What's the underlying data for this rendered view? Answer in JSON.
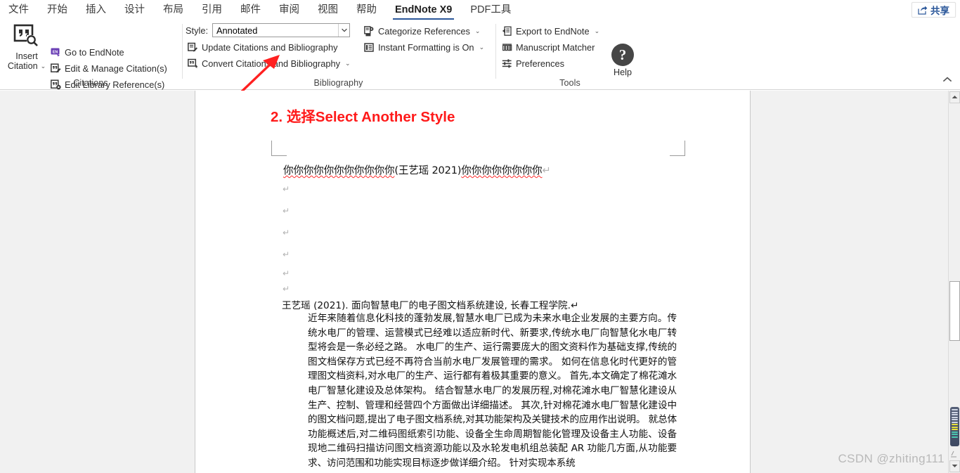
{
  "app": {
    "tabs": [
      {
        "label": "文件",
        "active": false
      },
      {
        "label": "开始",
        "active": false
      },
      {
        "label": "插入",
        "active": false
      },
      {
        "label": "设计",
        "active": false
      },
      {
        "label": "布局",
        "active": false
      },
      {
        "label": "引用",
        "active": false
      },
      {
        "label": "邮件",
        "active": false
      },
      {
        "label": "审阅",
        "active": false
      },
      {
        "label": "视图",
        "active": false
      },
      {
        "label": "帮助",
        "active": false
      },
      {
        "label": "EndNote X9",
        "active": true
      },
      {
        "label": "PDF工具",
        "active": false
      }
    ],
    "share_label": "共享",
    "share_icon": "share-icon",
    "accent_color": "#2b579a"
  },
  "ribbon": {
    "collapse_icon": "chevron-up-icon",
    "groups": [
      {
        "name": "citations",
        "label": "Citations",
        "big_button": {
          "line1": "Insert",
          "line2": "Citation",
          "icon": "insert-citation-icon",
          "caret": "⌄"
        },
        "items": [
          {
            "label": "Go to EndNote",
            "icon": "endnote-icon",
            "caret": ""
          },
          {
            "label": "Edit & Manage Citation(s)",
            "icon": "edit-citation-icon",
            "caret": ""
          },
          {
            "label": "Edit Library Reference(s)",
            "icon": "edit-library-icon",
            "caret": ""
          }
        ]
      },
      {
        "name": "bibliography",
        "label": "Bibliography",
        "style": {
          "label": "Style:",
          "value": "Annotated",
          "placeholder": "Annotated",
          "dropdown_icon": "chevron-down-icon"
        },
        "items": [
          {
            "label": "Update Citations and Bibliography",
            "icon": "update-bibliography-icon",
            "caret": ""
          },
          {
            "label": "Convert Citations and Bibliography",
            "icon": "convert-bibliography-icon",
            "caret": "⌄"
          },
          {
            "label": "Categorize References",
            "icon": "categorize-references-icon",
            "caret": "⌄"
          },
          {
            "label": "Instant Formatting is On",
            "icon": "instant-formatting-icon",
            "caret": "⌄"
          }
        ],
        "dialog_launcher_icon": "dialog-launcher-icon"
      },
      {
        "name": "tools",
        "label": "Tools",
        "items": [
          {
            "label": "Export to EndNote",
            "icon": "export-endnote-icon",
            "caret": "⌄"
          },
          {
            "label": "Manuscript Matcher",
            "icon": "manuscript-matcher-icon",
            "caret": ""
          },
          {
            "label": "Preferences",
            "icon": "preferences-icon",
            "caret": ""
          }
        ],
        "help": {
          "label": "Help",
          "glyph": "?",
          "icon": "help-icon"
        }
      }
    ]
  },
  "annotation": {
    "arrow_color": "#ff2020",
    "name": "red-arrow-annotation"
  },
  "document": {
    "heading": "2. 选择Select Another Style",
    "heading_color": "#ff1a1a",
    "citation_line": {
      "before": "你你你你你你你你你你你",
      "citation": "(王艺瑶 2021)",
      "after": "你你你你你你你你",
      "pilcrow": "↵"
    },
    "empty_paragraph_marks": [
      "↵",
      "↵",
      "↵",
      "↵",
      "↵",
      "↵"
    ],
    "bibliography_entry": "王艺瑶 (2021). 面向智慧电厂的电子图文档系统建设, 长春工程学院.↵",
    "abstract": "近年来随着信息化科技的蓬勃发展,智慧水电厂已成为未来水电企业发展的主要方向。传统水电厂的管理、运营模式已经难以适应新时代、新要求,传统水电厂向智慧化水电厂转型将会是一条必经之路。 水电厂的生产、运行需要庞大的图文资料作为基础支撑,传统的图文档保存方式已经不再符合当前水电厂发展管理的需求。 如何在信息化时代更好的管理图文档资料,对水电厂的生产、运行都有着极其重要的意义。 首先,本文确定了棉花滩水电厂智慧化建设及总体架构。 结合智慧水电厂的发展历程,对棉花滩水电厂智慧化建设从生产、控制、管理和经营四个方面做出详细描述。 其次,针对棉花滩水电厂智慧化建设中的图文档问题,提出了电子图文档系统,对其功能架构及关键技术的应用作出说明。 就总体功能概述后,对二维码图纸索引功能、设备全生命周期智能化管理及设备主人功能、设备现地二维码扫描访问图文档资源功能以及水轮发电机组总装配 AR 功能几方面,从功能要求、访问范围和功能实现目标逐步做详细介绍。 针对实现本系统"
  },
  "scrollbar": {
    "up_icon": "scroll-up-arrow-icon",
    "down_icon": "scroll-down-arrow-icon",
    "thumb_name": "scroll-thumb",
    "page_view_name": "page-thumbnail-indicator",
    "resizer_icon": "resize-grip-icon"
  },
  "watermark": "CSDN @zhiting111"
}
